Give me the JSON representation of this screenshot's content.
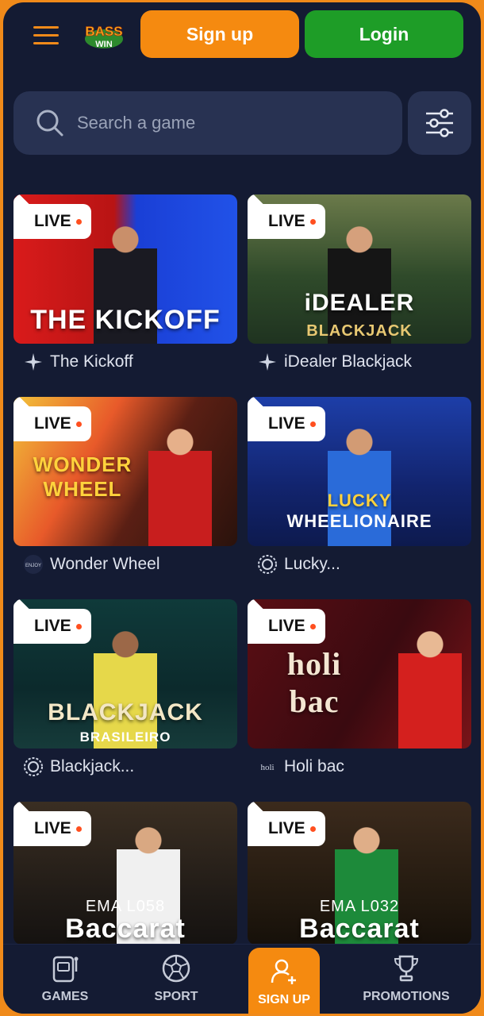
{
  "header": {
    "logo_text": "BASS WIN",
    "signup_label": "Sign up",
    "login_label": "Login"
  },
  "search": {
    "placeholder": "Search a game"
  },
  "live_badge": "LIVE",
  "games": [
    {
      "name": "The Kickoff",
      "thumb_title": "THE KICKOFF",
      "thumb_sub": "",
      "provider_icon": "star-icon"
    },
    {
      "name": "iDealer Blackjack",
      "thumb_title": "iDEALER",
      "thumb_sub": "BLACKJACK",
      "provider_icon": "star-icon"
    },
    {
      "name": "Wonder Wheel",
      "thumb_title": "WONDER WHEEL",
      "thumb_sub": "",
      "provider_icon": "enjoy-icon"
    },
    {
      "name": "Lucky...",
      "thumb_title": "LUCKY",
      "thumb_sub": "WHEELIONAIRE",
      "provider_icon": "spiral-icon"
    },
    {
      "name": "Blackjack...",
      "thumb_title": "BLACKJACK",
      "thumb_sub": "BRASILEIRO",
      "provider_icon": "spiral-icon"
    },
    {
      "name": "Holi bac",
      "thumb_title": "holi bac",
      "thumb_sub": "",
      "provider_icon": "holi-icon"
    },
    {
      "name": "",
      "thumb_title": "Baccarat",
      "thumb_sub": "EMA   L058",
      "provider_icon": ""
    },
    {
      "name": "",
      "thumb_title": "Baccarat",
      "thumb_sub": "EMA   L032",
      "provider_icon": ""
    }
  ],
  "nav": {
    "games": "GAMES",
    "sport": "SPORT",
    "signup": "SIGN UP",
    "promotions": "PROMOTIONS"
  },
  "colors": {
    "accent": "#f58a10",
    "login": "#1e9d27",
    "background": "#141b33"
  }
}
